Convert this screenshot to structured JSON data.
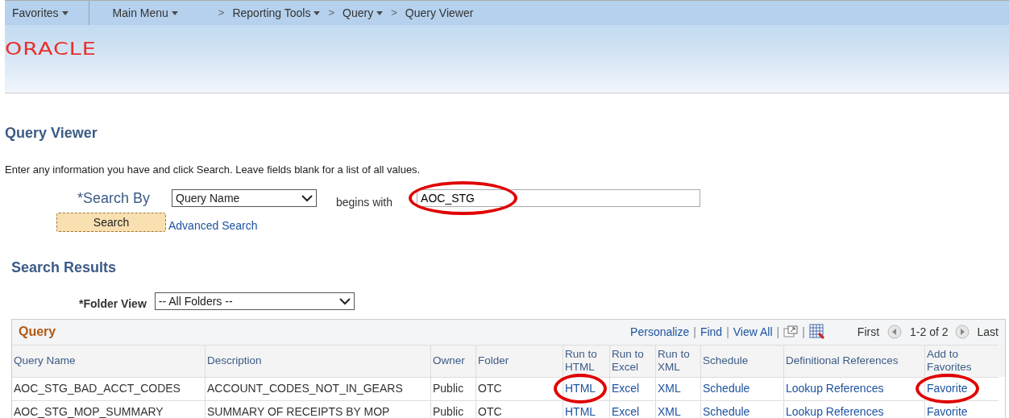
{
  "nav": {
    "items": [
      {
        "label": "Favorites",
        "dropdown": true
      },
      {
        "label": "Main Menu",
        "dropdown": true
      }
    ],
    "breadcrumbs": [
      {
        "label": "Reporting Tools",
        "dropdown": true
      },
      {
        "label": "Query",
        "dropdown": true
      },
      {
        "label": "Query Viewer",
        "dropdown": false
      }
    ],
    "separator": ">"
  },
  "brand": {
    "logo": "ORACLE"
  },
  "page_title": "Query Viewer",
  "instructions": "Enter any information you have and click Search. Leave fields blank for a list of all values.",
  "search": {
    "label": "*Search By",
    "search_by": "Query Name",
    "operator": "begins with",
    "value": "AOC_STG",
    "value_circled": true,
    "button": "Search",
    "advanced_link": "Advanced Search"
  },
  "results": {
    "title": "Search Results",
    "folder_label": "*Folder View",
    "folder_value": "-- All Folders --",
    "grid": {
      "title": "Query",
      "separator": "|",
      "tools": [
        {
          "kind": "link",
          "label": "Personalize"
        },
        {
          "kind": "link",
          "label": "Find"
        },
        {
          "kind": "link",
          "label": "View All"
        },
        {
          "kind": "window"
        },
        {
          "kind": "grid"
        }
      ],
      "nav": {
        "first": "First",
        "range": "1-2 of 2",
        "last": "Last"
      },
      "columns": [
        "Query Name",
        "Description",
        "Owner",
        "Folder",
        "Run to HTML",
        "Run to Excel",
        "Run to XML",
        "Schedule",
        "Definitional References",
        "Add to Favorites"
      ],
      "rows": [
        {
          "cells": [
            {
              "text": "AOC_STG_BAD_ACCT_CODES",
              "circled": false
            },
            {
              "text": "ACCOUNT_CODES_NOT_IN_GEARS",
              "circled": false
            },
            {
              "text": "Public",
              "circled": false
            },
            {
              "text": "OTC",
              "circled": false
            },
            {
              "text": "HTML",
              "circled": true
            },
            {
              "text": "Excel",
              "circled": false
            },
            {
              "text": "XML",
              "circled": false
            },
            {
              "text": "Schedule",
              "circled": false
            },
            {
              "text": "Lookup References",
              "circled": false
            },
            {
              "text": "Favorite",
              "circled": true
            }
          ]
        },
        {
          "cells": [
            {
              "text": "AOC_STG_MOP_SUMMARY",
              "circled": false
            },
            {
              "text": "SUMMARY OF RECEIPTS BY MOP",
              "circled": false
            },
            {
              "text": "Public",
              "circled": false
            },
            {
              "text": "OTC",
              "circled": false
            },
            {
              "text": "HTML",
              "circled": false
            },
            {
              "text": "Excel",
              "circled": false
            },
            {
              "text": "XML",
              "circled": false
            },
            {
              "text": "Schedule",
              "circled": false
            },
            {
              "text": "Lookup References",
              "circled": false
            },
            {
              "text": "Favorite",
              "circled": false
            }
          ]
        }
      ]
    }
  }
}
